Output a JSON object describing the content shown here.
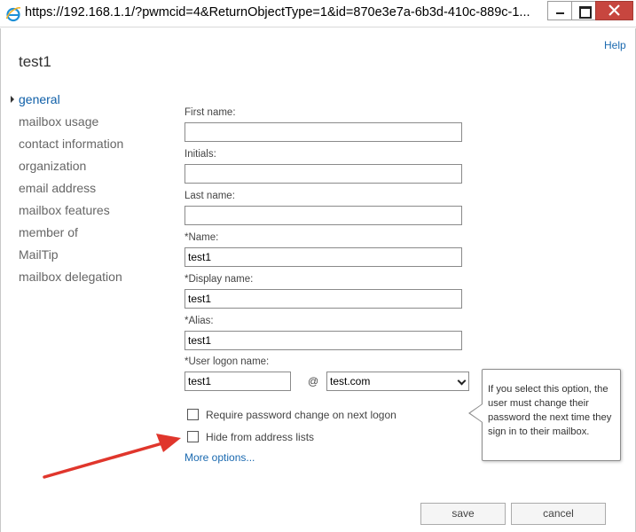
{
  "window": {
    "url": "https://192.168.1.1/?pwmcid=4&ReturnObjectType=1&id=870e3e7a-6b3d-410c-889c-1..."
  },
  "header": {
    "help_label": "Help",
    "title": "test1"
  },
  "nav": {
    "items": [
      {
        "label": "general",
        "active": true
      },
      {
        "label": "mailbox usage"
      },
      {
        "label": "contact information"
      },
      {
        "label": "organization"
      },
      {
        "label": "email address"
      },
      {
        "label": "mailbox features"
      },
      {
        "label": "member of"
      },
      {
        "label": "MailTip"
      },
      {
        "label": "mailbox delegation"
      }
    ]
  },
  "form": {
    "first_name": {
      "label": "First name:",
      "value": ""
    },
    "initials": {
      "label": "Initials:",
      "value": ""
    },
    "last_name": {
      "label": "Last name:",
      "value": ""
    },
    "name": {
      "label": "*Name:",
      "value": "test1"
    },
    "display_name": {
      "label": "*Display name:",
      "value": "test1"
    },
    "alias": {
      "label": "*Alias:",
      "value": "test1"
    },
    "user_logon": {
      "label": "*User logon name:",
      "value": "test1",
      "at": "@",
      "domain": "test.com"
    },
    "require_password_change": {
      "label": "Require password change on next logon",
      "checked": false
    },
    "hide_from_address_lists": {
      "label": "Hide from address lists",
      "checked": false
    },
    "more_options": "More options..."
  },
  "tooltip": {
    "text": "If you select this option, the user must change their password the next time they sign in to their mailbox."
  },
  "actions": {
    "save": "save",
    "cancel": "cancel"
  },
  "colors": {
    "accent": "#1b6ab0",
    "close_button": "#c7463f",
    "arrow": "#e0362c"
  }
}
